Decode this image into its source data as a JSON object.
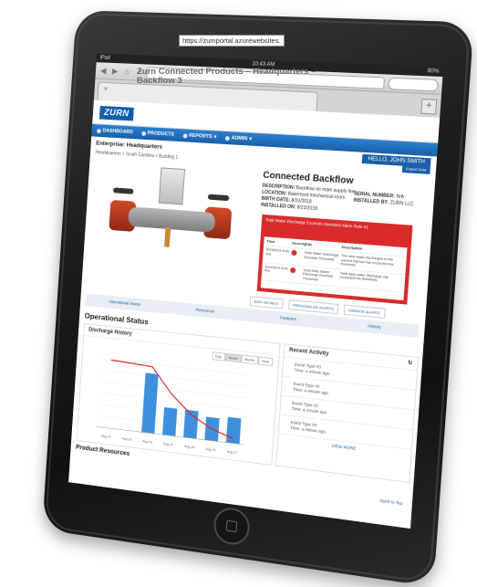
{
  "statusbar": {
    "left": "iPad",
    "time": "10:43 AM",
    "battery": "80%"
  },
  "browser": {
    "url": "https://zumportal.azurewebsites.",
    "tab_title_line1": "Zurn Connected Products – Headquarters –",
    "tab_title_line2": "Backflow 3"
  },
  "app": {
    "logo": "ZURN",
    "nav": [
      "DASHBOARD",
      "PRODUCTS",
      "REPORTS",
      "ADMIN"
    ],
    "enterprise": "Enterprise: Headquarters",
    "hello": "HELLO, JOHN SMITH",
    "breadcrumb": "Headquarters > South Carolina > Building 1",
    "export": "Export Data"
  },
  "product": {
    "title": "Connected Backflow",
    "description_label": "DESCRIPTION:",
    "description": "Backflow on main supply line",
    "location_label": "LOCATION:",
    "location": "Basement mechanical room",
    "birth_label": "BIRTH DATE:",
    "birth": "8/23/2018",
    "installed_on_label": "INSTALLED ON:",
    "installed_on": "8/23/2018",
    "serial_label": "SERIAL NUMBER:",
    "serial": "N/A",
    "installed_by_label": "INSTALLED BY:",
    "installed_by": "ZURN LLC"
  },
  "alert": {
    "message": "Total Water Discharge Exceeds Standard Alarm Rule #1",
    "columns": [
      "Time",
      "Severity",
      "Title",
      "Description"
    ],
    "rows": [
      {
        "time": "8/23/2019 8:46 PM",
        "title": "Total Water Discharge Exceeds Threshold",
        "desc": "The total water discharged in the current interval has exceeded the threshold."
      },
      {
        "time": "8/23/2019 8:45 PM",
        "title": "Total Daily Water Discharge Exceeds Threshold",
        "desc": "Total daily water discharge has exceeded the threshold."
      }
    ]
  },
  "actions": [
    "EDIT DETAILS",
    "PERSONALIZE ALERTS",
    "MANAGE ALERTS"
  ],
  "subtabs": [
    "Operational Status",
    "Resources",
    "Features",
    "History"
  ],
  "operational": {
    "heading": "Operational Status",
    "panel_title": "Discharge History",
    "range": [
      "Day",
      "Week",
      "Month",
      "Year"
    ]
  },
  "activity": {
    "title": "Recent Activity",
    "items": [
      {
        "type": "Event Type #3",
        "time": "Time: a minute ago"
      },
      {
        "type": "Event Type #2",
        "time": "Time: a minute ago"
      },
      {
        "type": "Event Type #1",
        "time": "Time: a minute ago"
      },
      {
        "type": "Event Type #0",
        "time": "Time: a minute ago"
      }
    ],
    "view_more": "VIEW MORE"
  },
  "footer": {
    "resources": "Product Resources",
    "back_to_top": "Back to Top"
  },
  "chart_data": {
    "type": "bar",
    "categories": [
      "Aug 21",
      "Aug 22",
      "Aug 23",
      "Aug 24",
      "Aug 25",
      "Aug 26",
      "Aug 27"
    ],
    "values": [
      0,
      0,
      2600,
      1200,
      1200,
      1000,
      1100
    ],
    "line_values": [
      3000,
      2950,
      2900,
      1800,
      1000,
      500,
      200
    ],
    "ylim": [
      0,
      3200
    ],
    "colors": {
      "bar": "#3e8fde",
      "line": "#e2231a"
    }
  }
}
